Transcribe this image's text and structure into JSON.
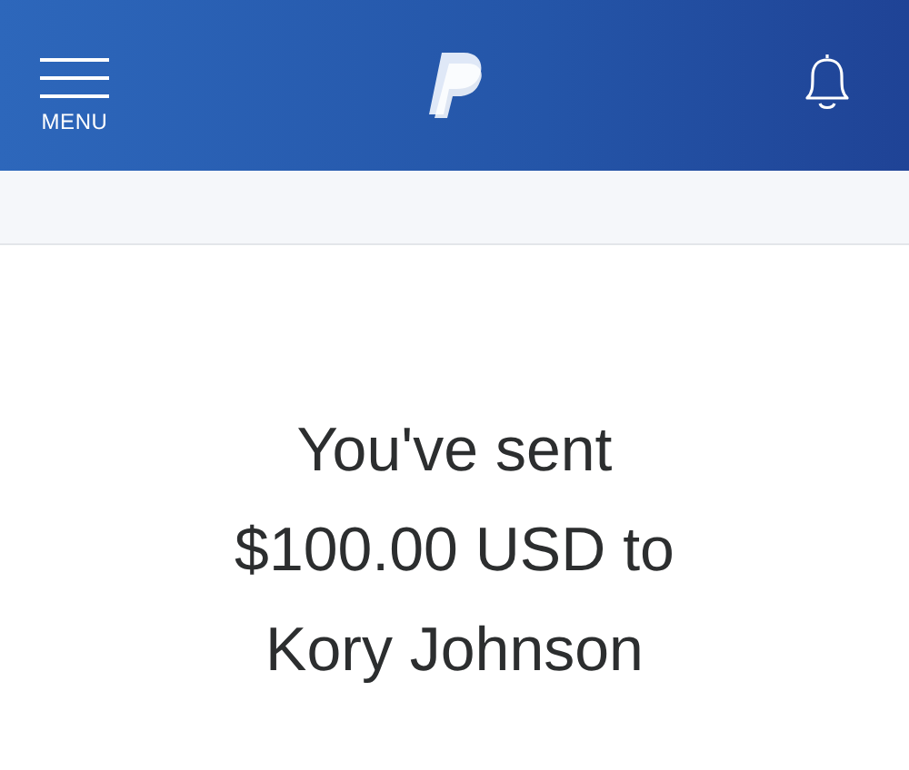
{
  "header": {
    "menu_label": "MENU"
  },
  "confirmation": {
    "message_lines": [
      "You've sent",
      "$100.00 USD to",
      "Kory Johnson"
    ]
  }
}
